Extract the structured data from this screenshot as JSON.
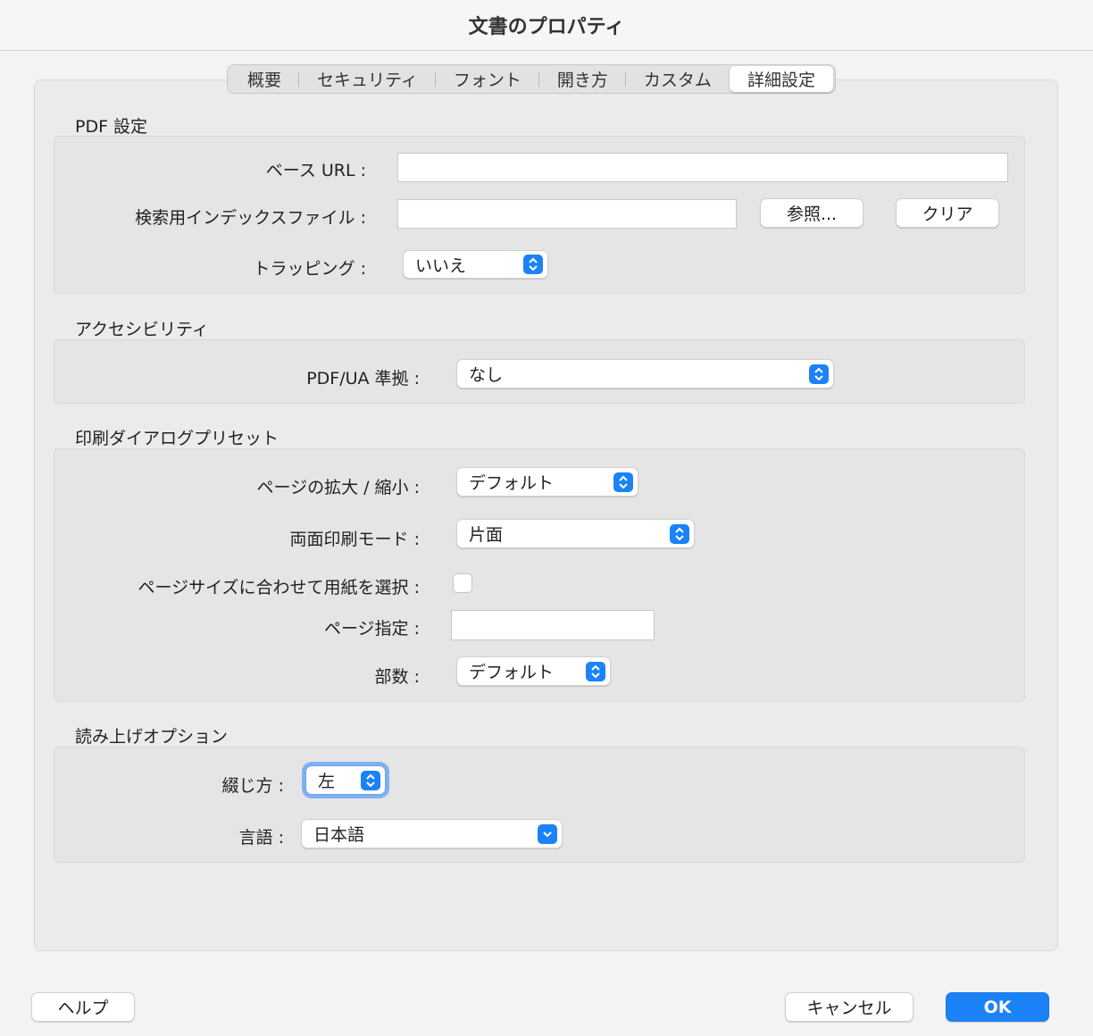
{
  "window": {
    "title": "文書のプロパティ"
  },
  "tabs": [
    {
      "label": "概要"
    },
    {
      "label": "セキュリティ"
    },
    {
      "label": "フォント"
    },
    {
      "label": "開き方"
    },
    {
      "label": "カスタム"
    },
    {
      "label": "詳細設定",
      "active": true
    }
  ],
  "pdf_settings": {
    "title": "PDF 設定",
    "base_url_label": "ベース URL :",
    "base_url_value": "",
    "search_index_label": "検索用インデックスファイル :",
    "search_index_value": "",
    "browse_button": "参照...",
    "clear_button": "クリア",
    "trapping_label": "トラッピング :",
    "trapping_value": "いいえ"
  },
  "accessibility": {
    "title": "アクセシビリティ",
    "pdfua_label": "PDF/UA 準拠 :",
    "pdfua_value": "なし"
  },
  "print_preset": {
    "title": "印刷ダイアログプリセット",
    "scaling_label": "ページの拡大 / 縮小 :",
    "scaling_value": "デフォルト",
    "duplex_label": "両面印刷モード :",
    "duplex_value": "片面",
    "paper_by_size_label": "ページサイズに合わせて用紙を選択 :",
    "paper_by_size_checked": false,
    "page_range_label": "ページ指定 :",
    "page_range_value": "",
    "copies_label": "部数 :",
    "copies_value": "デフォルト"
  },
  "reading": {
    "title": "読み上げオプション",
    "binding_label": "綴じ方 :",
    "binding_value": "左",
    "language_label": "言語 :",
    "language_value": "日本語"
  },
  "footer": {
    "help_button": "ヘルプ",
    "cancel_button": "キャンセル",
    "ok_button": "OK"
  },
  "colors": {
    "accent": "#1b82f7",
    "focus_ring": "#7fb1f3"
  }
}
